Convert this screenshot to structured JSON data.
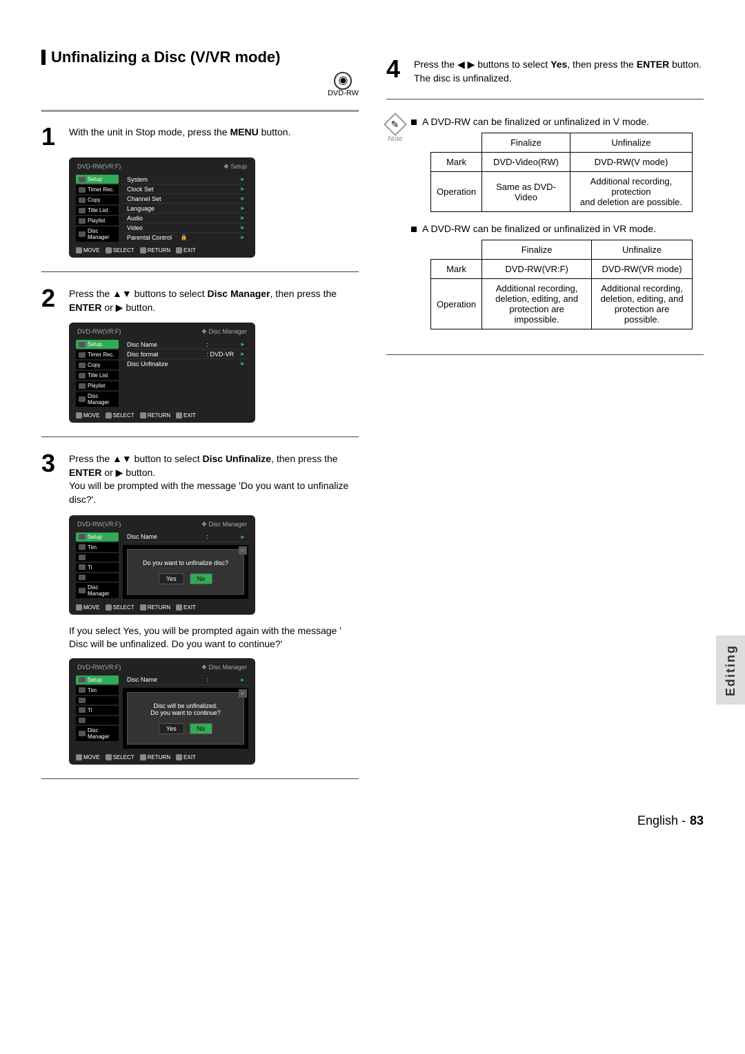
{
  "section_title": "Unfinalizing a Disc (V/VR mode)",
  "disc_label": "DVD-RW",
  "steps": {
    "s1": {
      "num": "1",
      "text_a": "With the unit in Stop mode, press the ",
      "text_b": "MENU",
      "text_c": " button."
    },
    "s2": {
      "num": "2",
      "text_a": "Press the ▲▼ buttons to select ",
      "text_b": "Disc Manager",
      "text_c": ", then press the ",
      "text_d": "ENTER",
      "text_e": " or ▶ button."
    },
    "s3": {
      "num": "3",
      "text_a": "Press the ▲▼ button to select ",
      "text_b": "Disc Unfinalize",
      "text_c": ", then press the ",
      "text_d": "ENTER",
      "text_e": " or ▶ button.",
      "line2": "You will be prompted with the message 'Do you want to unfinalize disc?'."
    },
    "s4": {
      "num": "4",
      "text_a": "Press the ◀ ▶ buttons to select ",
      "text_b": "Yes",
      "text_c": ", then press the ",
      "text_d": "ENTER",
      "text_e": " button.",
      "line2": "The disc is unfinalized."
    }
  },
  "mid_para": "If you select Yes, you will be prompted again with the message ' Disc will be unfinalized. Do you want to continue?'",
  "osd_common": {
    "title": "DVD-RW(VR:F)",
    "setup_crumb": "❖  Setup",
    "dm_crumb": "❖  Disc Manager",
    "side_items": [
      "Setup",
      "Timer Rec.",
      "Copy",
      "Title List",
      "Playlist",
      "Disc Manager"
    ],
    "foot": [
      "MOVE",
      "SELECT",
      "RETURN",
      "EXIT"
    ]
  },
  "osd1_list": [
    {
      "label": "System"
    },
    {
      "label": "Clock Set"
    },
    {
      "label": "Channel Set"
    },
    {
      "label": "Language"
    },
    {
      "label": "Audio"
    },
    {
      "label": "Video"
    },
    {
      "label": "Parental Control",
      "lock": true
    }
  ],
  "osd2_list": [
    {
      "label": "Disc Name",
      "mid": ":"
    },
    {
      "label": "Disc format",
      "mid": ": DVD-VR"
    },
    {
      "label": "Disc Unfinalize",
      "mid": ""
    }
  ],
  "osd3": {
    "top_label": "Disc Name",
    "prompt": "Do you want to unfinalize disc?",
    "yes": "Yes",
    "no": "No"
  },
  "osd4": {
    "top_label": "Disc Name",
    "prompt1": "Disc will be unfinalized.",
    "prompt2": "Do you want to continue?",
    "yes": "Yes",
    "no": "No"
  },
  "note_label": "Note",
  "note1": "A DVD-RW can be finalized or unfinalized in V mode.",
  "note2": "A DVD-RW can be finalized or unfinalized in VR mode.",
  "table1": {
    "h_fin": "Finalize",
    "h_unf": "Unfinalize",
    "r1_label": "Mark",
    "r1_fin": "DVD-Video(RW)",
    "r1_unf": "DVD-RW(V mode)",
    "r2_label": "Operation",
    "r2_fin": "Same as DVD-Video",
    "r2_unf_a": "Additional recording, protection",
    "r2_unf_b": "and deletion are possible."
  },
  "table2": {
    "h_fin": "Finalize",
    "h_unf": "Unfinalize",
    "r1_label": "Mark",
    "r1_fin": "DVD-RW(VR:F)",
    "r1_unf": "DVD-RW(VR mode)",
    "r2_label": "Operation",
    "r2_fin_a": "Additional recording,",
    "r2_fin_b": "deletion, editing, and",
    "r2_fin_c": "protection are impossible.",
    "r2_unf_a": "Additional recording,",
    "r2_unf_b": "deletion, editing, and",
    "r2_unf_c": "protection are possible."
  },
  "side_tab": "Editing",
  "footer_lang": "English -",
  "footer_page": "83"
}
